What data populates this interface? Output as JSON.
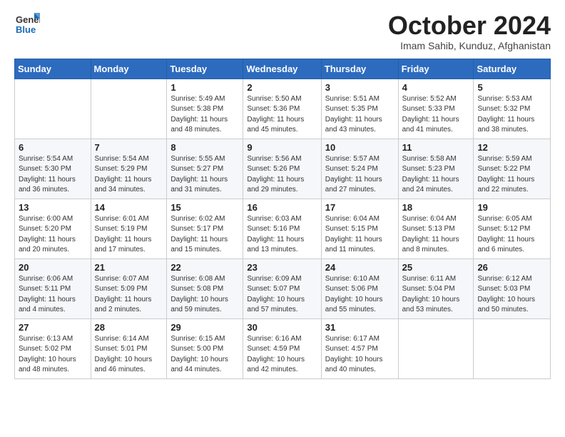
{
  "logo": {
    "general": "General",
    "blue": "Blue"
  },
  "title": "October 2024",
  "subtitle": "Imam Sahib, Kunduz, Afghanistan",
  "weekdays": [
    "Sunday",
    "Monday",
    "Tuesday",
    "Wednesday",
    "Thursday",
    "Friday",
    "Saturday"
  ],
  "weeks": [
    [
      {
        "day": "",
        "info": ""
      },
      {
        "day": "",
        "info": ""
      },
      {
        "day": "1",
        "info": "Sunrise: 5:49 AM\nSunset: 5:38 PM\nDaylight: 11 hours and 48 minutes."
      },
      {
        "day": "2",
        "info": "Sunrise: 5:50 AM\nSunset: 5:36 PM\nDaylight: 11 hours and 45 minutes."
      },
      {
        "day": "3",
        "info": "Sunrise: 5:51 AM\nSunset: 5:35 PM\nDaylight: 11 hours and 43 minutes."
      },
      {
        "day": "4",
        "info": "Sunrise: 5:52 AM\nSunset: 5:33 PM\nDaylight: 11 hours and 41 minutes."
      },
      {
        "day": "5",
        "info": "Sunrise: 5:53 AM\nSunset: 5:32 PM\nDaylight: 11 hours and 38 minutes."
      }
    ],
    [
      {
        "day": "6",
        "info": "Sunrise: 5:54 AM\nSunset: 5:30 PM\nDaylight: 11 hours and 36 minutes."
      },
      {
        "day": "7",
        "info": "Sunrise: 5:54 AM\nSunset: 5:29 PM\nDaylight: 11 hours and 34 minutes."
      },
      {
        "day": "8",
        "info": "Sunrise: 5:55 AM\nSunset: 5:27 PM\nDaylight: 11 hours and 31 minutes."
      },
      {
        "day": "9",
        "info": "Sunrise: 5:56 AM\nSunset: 5:26 PM\nDaylight: 11 hours and 29 minutes."
      },
      {
        "day": "10",
        "info": "Sunrise: 5:57 AM\nSunset: 5:24 PM\nDaylight: 11 hours and 27 minutes."
      },
      {
        "day": "11",
        "info": "Sunrise: 5:58 AM\nSunset: 5:23 PM\nDaylight: 11 hours and 24 minutes."
      },
      {
        "day": "12",
        "info": "Sunrise: 5:59 AM\nSunset: 5:22 PM\nDaylight: 11 hours and 22 minutes."
      }
    ],
    [
      {
        "day": "13",
        "info": "Sunrise: 6:00 AM\nSunset: 5:20 PM\nDaylight: 11 hours and 20 minutes."
      },
      {
        "day": "14",
        "info": "Sunrise: 6:01 AM\nSunset: 5:19 PM\nDaylight: 11 hours and 17 minutes."
      },
      {
        "day": "15",
        "info": "Sunrise: 6:02 AM\nSunset: 5:17 PM\nDaylight: 11 hours and 15 minutes."
      },
      {
        "day": "16",
        "info": "Sunrise: 6:03 AM\nSunset: 5:16 PM\nDaylight: 11 hours and 13 minutes."
      },
      {
        "day": "17",
        "info": "Sunrise: 6:04 AM\nSunset: 5:15 PM\nDaylight: 11 hours and 11 minutes."
      },
      {
        "day": "18",
        "info": "Sunrise: 6:04 AM\nSunset: 5:13 PM\nDaylight: 11 hours and 8 minutes."
      },
      {
        "day": "19",
        "info": "Sunrise: 6:05 AM\nSunset: 5:12 PM\nDaylight: 11 hours and 6 minutes."
      }
    ],
    [
      {
        "day": "20",
        "info": "Sunrise: 6:06 AM\nSunset: 5:11 PM\nDaylight: 11 hours and 4 minutes."
      },
      {
        "day": "21",
        "info": "Sunrise: 6:07 AM\nSunset: 5:09 PM\nDaylight: 11 hours and 2 minutes."
      },
      {
        "day": "22",
        "info": "Sunrise: 6:08 AM\nSunset: 5:08 PM\nDaylight: 10 hours and 59 minutes."
      },
      {
        "day": "23",
        "info": "Sunrise: 6:09 AM\nSunset: 5:07 PM\nDaylight: 10 hours and 57 minutes."
      },
      {
        "day": "24",
        "info": "Sunrise: 6:10 AM\nSunset: 5:06 PM\nDaylight: 10 hours and 55 minutes."
      },
      {
        "day": "25",
        "info": "Sunrise: 6:11 AM\nSunset: 5:04 PM\nDaylight: 10 hours and 53 minutes."
      },
      {
        "day": "26",
        "info": "Sunrise: 6:12 AM\nSunset: 5:03 PM\nDaylight: 10 hours and 50 minutes."
      }
    ],
    [
      {
        "day": "27",
        "info": "Sunrise: 6:13 AM\nSunset: 5:02 PM\nDaylight: 10 hours and 48 minutes."
      },
      {
        "day": "28",
        "info": "Sunrise: 6:14 AM\nSunset: 5:01 PM\nDaylight: 10 hours and 46 minutes."
      },
      {
        "day": "29",
        "info": "Sunrise: 6:15 AM\nSunset: 5:00 PM\nDaylight: 10 hours and 44 minutes."
      },
      {
        "day": "30",
        "info": "Sunrise: 6:16 AM\nSunset: 4:59 PM\nDaylight: 10 hours and 42 minutes."
      },
      {
        "day": "31",
        "info": "Sunrise: 6:17 AM\nSunset: 4:57 PM\nDaylight: 10 hours and 40 minutes."
      },
      {
        "day": "",
        "info": ""
      },
      {
        "day": "",
        "info": ""
      }
    ]
  ]
}
